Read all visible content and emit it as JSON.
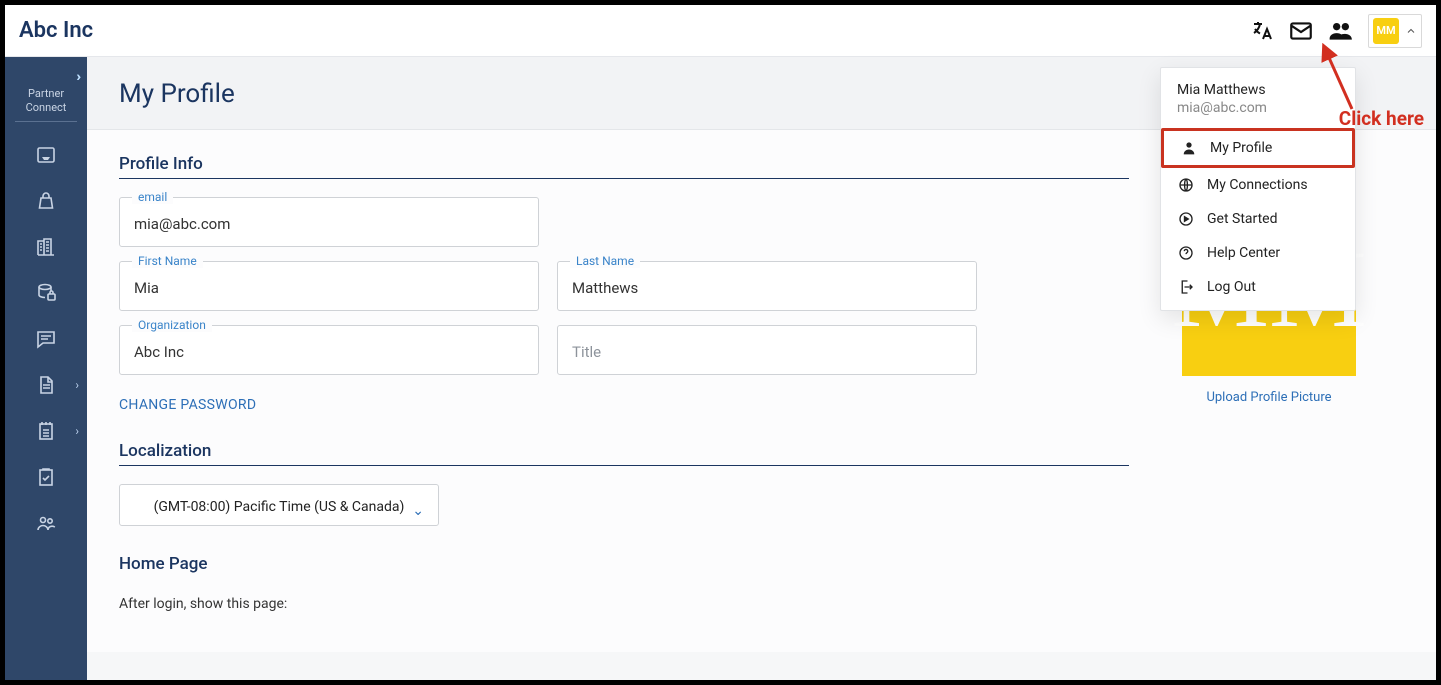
{
  "brand": "Abc Inc",
  "avatar_initials": "MM",
  "sidebar": {
    "label_line1": "Partner",
    "label_line2": "Connect"
  },
  "page": {
    "title": "My Profile",
    "sections": {
      "profile_info": "Profile Info",
      "localization": "Localization",
      "home_page": "Home Page"
    },
    "fields": {
      "email_label": "email",
      "email_value": "mia@abc.com",
      "first_name_label": "First Name",
      "first_name_value": "Mia",
      "last_name_label": "Last Name",
      "last_name_value": "Matthews",
      "org_label": "Organization",
      "org_value": "Abc Inc",
      "title_placeholder": "Title"
    },
    "change_password": "CHANGE PASSWORD",
    "timezone": "(GMT-08:00) Pacific Time (US & Canada)",
    "home_page_text": "After login, show this page:"
  },
  "profile_pic": {
    "initials": "MM",
    "upload_label": "Upload Profile Picture"
  },
  "menu": {
    "name": "Mia Matthews",
    "email": "mia@abc.com",
    "items": {
      "my_profile": "My Profile",
      "my_connections": "My Connections",
      "get_started": "Get Started",
      "help_center": "Help Center",
      "log_out": "Log Out"
    }
  },
  "callout": "Click here"
}
